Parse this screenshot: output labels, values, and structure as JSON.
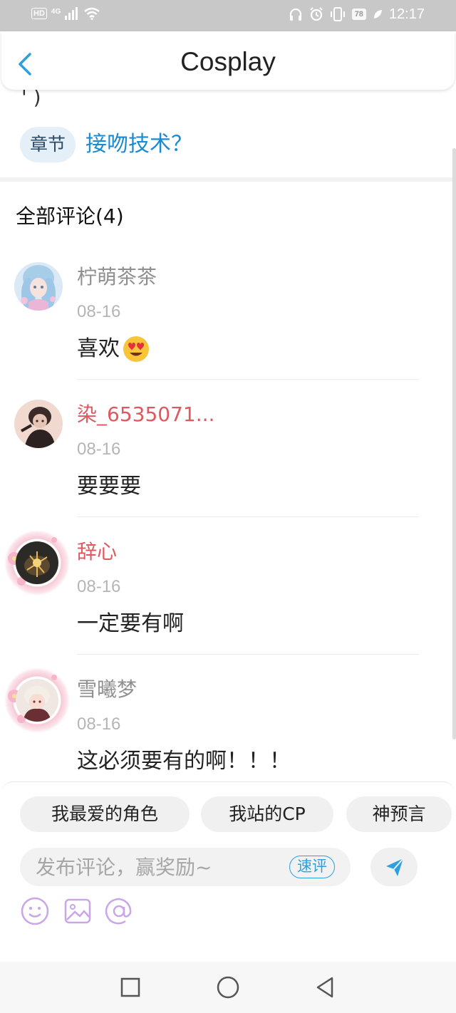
{
  "status_bar": {
    "hd": "HD",
    "network": "4G",
    "battery": "78",
    "time": "12:17"
  },
  "header": {
    "title": "Cosplay"
  },
  "partial_text": "' )",
  "chapter": {
    "tag": "章节",
    "title": "接吻技术？"
  },
  "comments_section": {
    "title": "全部评论(4)",
    "items": [
      {
        "username": "柠萌茶茶",
        "date": "08-16",
        "text": "喜欢",
        "username_color": "#8f8f8f",
        "has_emoji": true
      },
      {
        "username": "染_6535071...",
        "date": "08-16",
        "text": "要要要",
        "username_color": "#e0585f",
        "has_emoji": false
      },
      {
        "username": "辞心",
        "date": "08-16",
        "text": "一定要有啊",
        "username_color": "#e0585f",
        "has_emoji": false
      },
      {
        "username": "雪曦梦",
        "date": "08-16",
        "text": "这必须要有的啊！！！",
        "username_color": "#8f8f8f",
        "has_emoji": false
      }
    ]
  },
  "quick_tags": [
    "我最爱的角色",
    "我站的CP",
    "神预言"
  ],
  "comment_input": {
    "placeholder": "发布评论，赢奖励~",
    "quick_comment_label": "速评"
  },
  "icons": {
    "back": "chevron-left-icon",
    "emoji": "smiley-icon",
    "image": "image-icon",
    "mention": "at-icon",
    "send": "send-icon"
  },
  "colors": {
    "accent": "#2aa0e0",
    "link": "#1a8bd0",
    "vip_name": "#e0585f",
    "tool_icon": "#c9a6e8"
  }
}
